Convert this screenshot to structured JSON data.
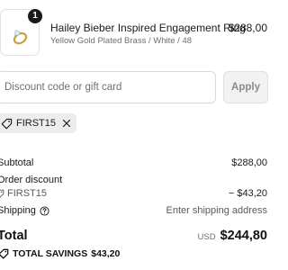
{
  "product": {
    "quantity": "1",
    "name": "Hailey Bieber Inspired Engagement Ring",
    "variant": "Yellow Gold Plated Brass / White / 48",
    "price": "$288,00",
    "thumbnail_icon": "ring-icon"
  },
  "discount": {
    "placeholder": "Discount code or gift card",
    "value": "",
    "apply_label": "Apply",
    "applied_code": "FIRST15"
  },
  "summary": {
    "subtotal_label": "Subtotal",
    "subtotal_value": "$288,00",
    "order_discount_label": "Order discount",
    "discount_code": "FIRST15",
    "discount_value": "− $43,20",
    "shipping_label": "Shipping",
    "shipping_value": "Enter shipping address",
    "total_label": "Total",
    "currency": "USD",
    "total_value": "$244,80",
    "savings_label": "TOTAL SAVINGS",
    "savings_value": "$43,20"
  },
  "colors": {
    "text": "#141414",
    "muted": "#707070",
    "badge_bg": "#1a1a1a",
    "chip_bg": "#ededed",
    "apply_bg": "#f2f2f2"
  }
}
